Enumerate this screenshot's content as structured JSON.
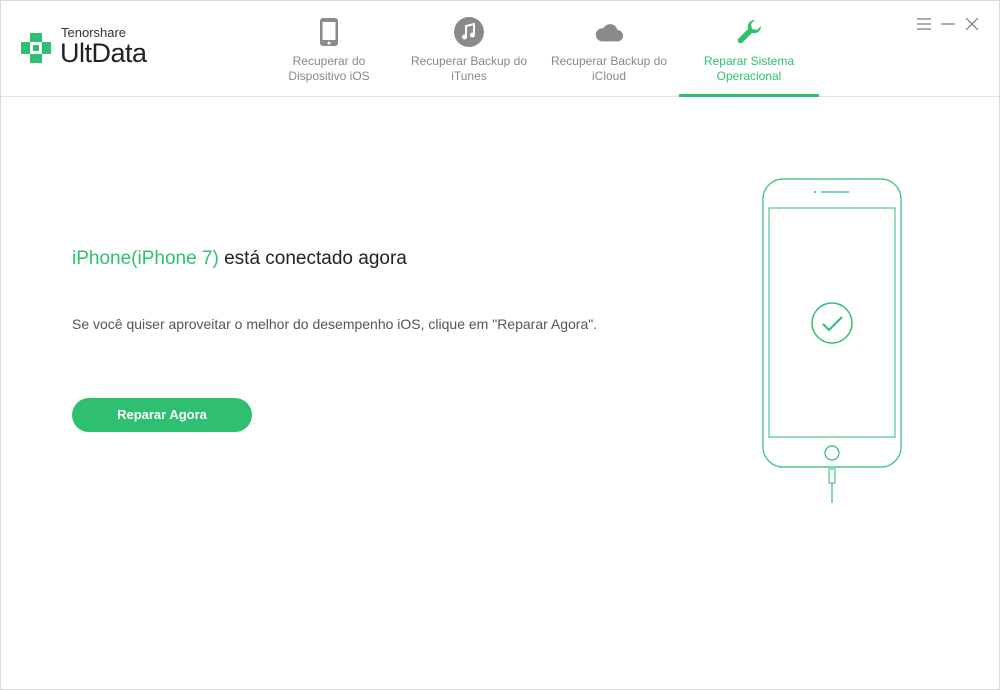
{
  "app": {
    "brand": "Tenorshare",
    "product": "UltData"
  },
  "tabs": [
    {
      "label": "Recuperar do\nDispositivo iOS",
      "icon": "iphone-icon",
      "active": false
    },
    {
      "label": "Recuperar Backup do\niTunes",
      "icon": "music-note-icon",
      "active": false
    },
    {
      "label": "Recuperar Backup do\niCloud",
      "icon": "cloud-icon",
      "active": false
    },
    {
      "label": "Reparar Sistema\nOperacional",
      "icon": "wrench-icon",
      "active": true
    }
  ],
  "window_controls": [
    "menu-icon",
    "minimize-icon",
    "close-icon"
  ],
  "main": {
    "device_name": "iPhone(iPhone 7)",
    "status_text": " está conectado agora",
    "description": "Se você quiser aproveitar o melhor do desempenho iOS, clique em \"Reparar Agora\".",
    "repair_button": "Reparar Agora"
  },
  "colors": {
    "accent": "#2fbf71",
    "icon_gray": "#8a8a8a",
    "text": "#222222"
  }
}
